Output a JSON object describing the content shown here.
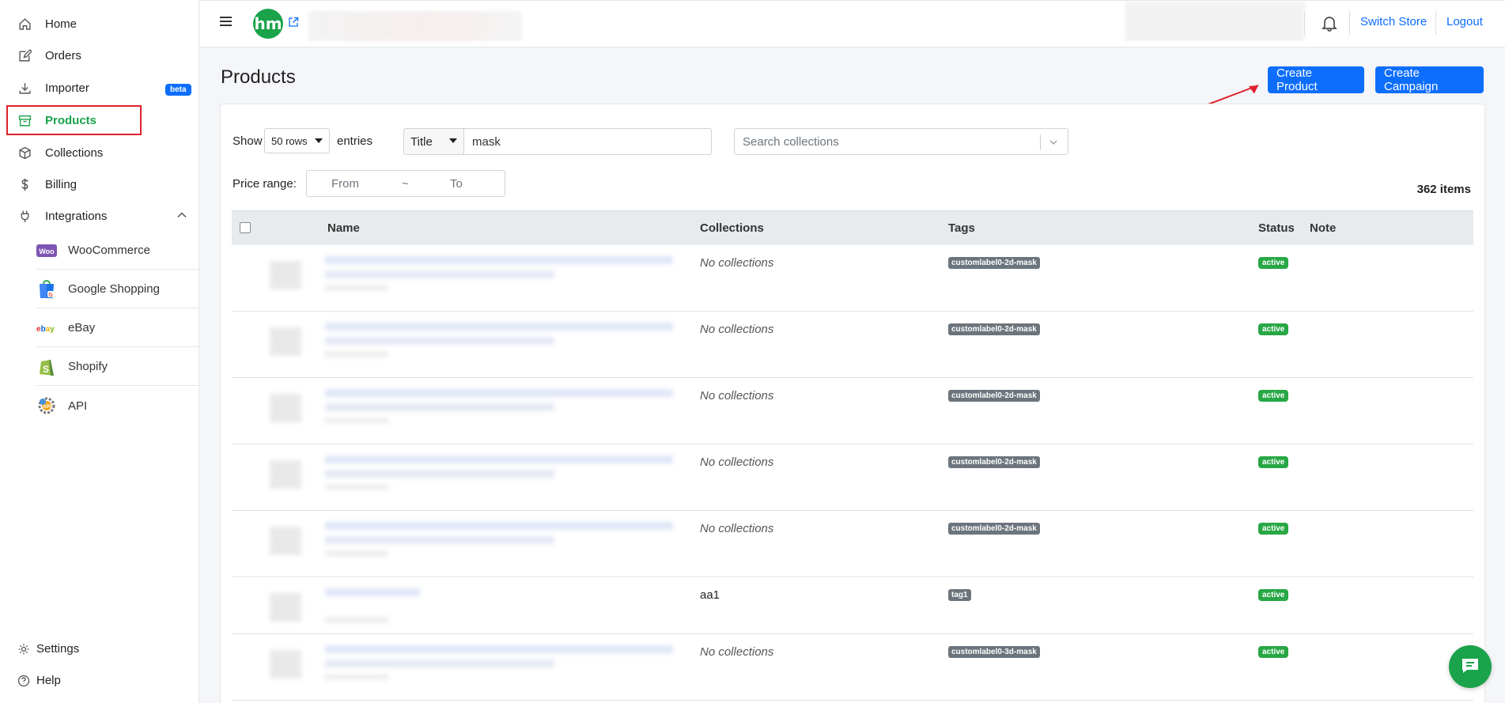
{
  "sidebar": {
    "items": [
      {
        "label": "Home",
        "icon": "home-icon"
      },
      {
        "label": "Orders",
        "icon": "edit-icon"
      },
      {
        "label": "Importer",
        "icon": "download-icon",
        "badge": "beta"
      },
      {
        "label": "Products",
        "icon": "box-icon",
        "active": true
      },
      {
        "label": "Collections",
        "icon": "cube-icon"
      },
      {
        "label": "Billing",
        "icon": "dollar-icon"
      },
      {
        "label": "Integrations",
        "icon": "plug-icon",
        "expanded": true
      }
    ],
    "integrations": [
      {
        "label": "WooCommerce",
        "logo": "woocommerce-logo"
      },
      {
        "label": "Google Shopping",
        "logo": "google-shopping-logo"
      },
      {
        "label": "eBay",
        "logo": "ebay-logo"
      },
      {
        "label": "Shopify",
        "logo": "shopify-logo"
      },
      {
        "label": "API",
        "logo": "api-logo"
      }
    ],
    "bottom": [
      {
        "label": "Settings",
        "icon": "gear-icon"
      },
      {
        "label": "Help",
        "icon": "help-icon"
      }
    ]
  },
  "header": {
    "brand_initials": "hm",
    "switch_store": "Switch Store",
    "logout": "Logout"
  },
  "main": {
    "title": "Products",
    "create_product": "Create Product",
    "create_campaign": "Create Campaign",
    "filters": {
      "show_label": "Show",
      "rows_value": "50 rows",
      "entries_label": "entries",
      "field_value": "Title",
      "search_value": "mask",
      "collections_placeholder": "Search collections",
      "price_label": "Price range:",
      "price_from": "From",
      "price_sep": "~",
      "price_to": "To"
    },
    "items_count": "362 items",
    "table": {
      "columns": [
        "Name",
        "Collections",
        "Tags",
        "Status",
        "Note"
      ],
      "rows": [
        {
          "collections": "No collections",
          "tag": "customlabel0-2d-mask",
          "status": "active"
        },
        {
          "collections": "No collections",
          "tag": "customlabel0-2d-mask",
          "status": "active"
        },
        {
          "collections": "No collections",
          "tag": "customlabel0-2d-mask",
          "status": "active"
        },
        {
          "collections": "No collections",
          "tag": "customlabel0-2d-mask",
          "status": "active"
        },
        {
          "collections": "No collections",
          "tag": "customlabel0-2d-mask",
          "status": "active"
        },
        {
          "collections": "aa1",
          "tag": "tag1",
          "status": "active"
        },
        {
          "collections": "No collections",
          "tag": "customlabel0-3d-mask",
          "status": "active"
        }
      ]
    }
  },
  "colors": {
    "brand_green": "#1aa34a",
    "primary_blue": "#0d6efd",
    "annotation_red": "#e0202a"
  }
}
